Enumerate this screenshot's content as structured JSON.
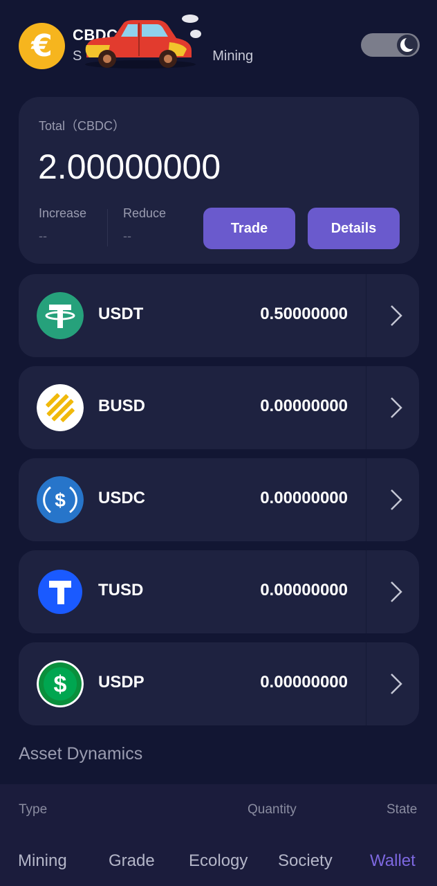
{
  "header": {
    "logo_symbol": "€",
    "title": "CBDC",
    "subtitle": "Mining",
    "theme_toggle_icon": "moon-icon"
  },
  "total": {
    "label": "Total（CBDC）",
    "value": "2.00000000",
    "increase_label": "Increase",
    "increase_value": "--",
    "reduce_label": "Reduce",
    "reduce_value": "--",
    "trade_label": "Trade",
    "details_label": "Details"
  },
  "coins": [
    {
      "name": "USDT",
      "amount": "0.50000000",
      "icon": "tether-icon",
      "color": "#26A17B"
    },
    {
      "name": "BUSD",
      "amount": "0.00000000",
      "icon": "busd-icon",
      "color": "#F0B90B"
    },
    {
      "name": "USDC",
      "amount": "0.00000000",
      "icon": "usdc-icon",
      "color": "#2775CA"
    },
    {
      "name": "TUSD",
      "amount": "0.00000000",
      "icon": "tusd-icon",
      "color": "#1A5AFF"
    },
    {
      "name": "USDP",
      "amount": "0.00000000",
      "icon": "usdp-icon",
      "color": "#00A650"
    }
  ],
  "asset_dynamics": {
    "title": "Asset Dynamics",
    "columns": [
      "Type",
      "Quantity",
      "State"
    ]
  },
  "nav": {
    "items": [
      "Mining",
      "Grade",
      "Ecology",
      "Society",
      "Wallet"
    ],
    "active": "Wallet"
  },
  "colors": {
    "background": "#121633",
    "card": "#1e2240",
    "accent": "#6a5acd",
    "active_nav": "#7d68e0"
  }
}
